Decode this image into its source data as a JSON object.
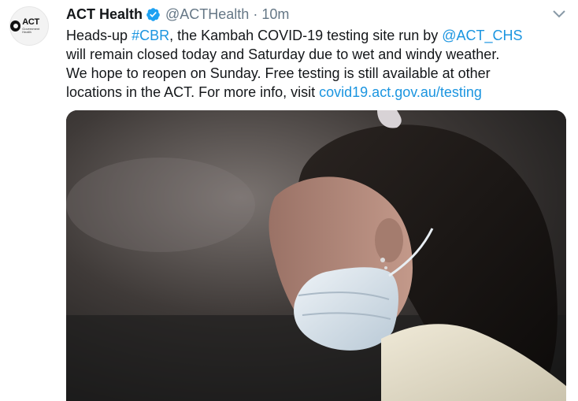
{
  "tweet": {
    "display_name": "ACT Health",
    "handle": "@ACTHealth",
    "separator": "·",
    "time": "10m",
    "avatar": {
      "logo_main": "ACT",
      "logo_sub": "Government Health"
    },
    "text": {
      "l1_a": "Heads-up ",
      "l1_hashtag": "#CBR",
      "l1_b": ", the Kambah COVID-19 testing site run by ",
      "l1_mention": "@ACT_CHS",
      "l2": "will remain closed today and Saturday due to wet and windy weather.",
      "l3": "We hope to reopen on Sunday. Free testing is still available at other",
      "l4_a": "locations in the ACT. For more info, visit ",
      "l4_link": "covid19.act.gov.au/testing"
    },
    "icons": {
      "verified": "verified-badge-icon",
      "caret": "chevron-down-icon"
    },
    "colors": {
      "link": "#1b95e0",
      "verified": "#1da1f2",
      "secondary_text": "#657786"
    }
  }
}
